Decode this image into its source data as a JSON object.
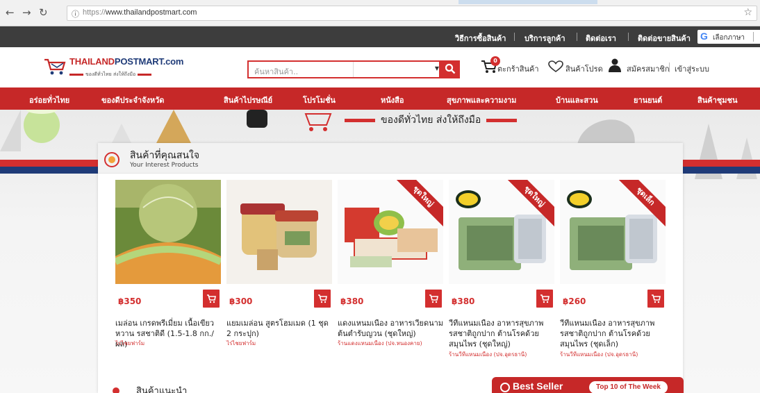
{
  "browser": {
    "url_scheme": "https://",
    "url_host": "www.thailandpostmart.com",
    "icons": [
      "back-icon",
      "forward-icon",
      "reload-icon",
      "info-icon",
      "bookmark-star-icon"
    ]
  },
  "topbar": {
    "links": [
      "วิธีการซื้อสินค้า",
      "บริการลูกค้า",
      "ติดต่อเรา",
      "ติดต่อขายสินค้า"
    ],
    "language_label": "เลือกภาษา"
  },
  "header": {
    "logo_brand_red": "THAILAND",
    "logo_brand_blue": "POSTMART.com",
    "logo_tagline": "ของดีทั่วไทย ส่งให้ถึงมือ",
    "search_placeholder": "ค้นหาสินค้า..",
    "cart_count": "0",
    "cart_label": "ตะกร้าสินค้า",
    "wishlist_label": "สินค้าโปรด",
    "register_label": "สมัครสมาชิก",
    "login_label": "เข้าสู่ระบบ"
  },
  "categories": [
    "อร่อยทั่วไทย",
    "ของดีประจำจังหวัด",
    "สินค้าไปรษณีย์",
    "โปรโมชั่น",
    "หนังสือ",
    "สุขภาพและความงาม",
    "บ้านและสวน",
    "ยานยนต์",
    "สินค้าชุมชน"
  ],
  "hero": {
    "tagline": "ของดีทั่วไทย ส่งให้ถึงมือ"
  },
  "interest": {
    "title": "สินค้าที่คุณสนใจ",
    "subtitle": "Your Interest Products",
    "products": [
      {
        "price": "฿350",
        "name": "เมล่อน เกรดพรีเมี่ยม เนื้อเขียว หวาน รสชาติดี (1.5-1.8 กก./ผล)",
        "shop": "ไร่ไชยฟาร์ม",
        "ribbon": ""
      },
      {
        "price": "฿300",
        "name": "แยมเมล่อน สูตรโฮมเมด (1 ชุด 2 กระปุก)",
        "shop": "ไร่ไชยฟาร์ม",
        "ribbon": ""
      },
      {
        "price": "฿380",
        "name": "แดงแหนมเนือง อาหารเวียดนาม ต้นตำรับญวน (ชุดใหญ่)",
        "shop": "ร้านแดงแหนมเนือง (ปจ.หนองคาย)",
        "ribbon": "ชุดใหญ่"
      },
      {
        "price": "฿380",
        "name": "วีทีแหนมเนือง อาหารสุขภาพ รสชาติถูกปาก ต้านโรคด้วย สมุนไพร (ชุดใหญ่)",
        "shop": "ร้านวีทีแหนมเนือง (ปจ.อุดรธานี)",
        "ribbon": "ชุดใหญ่"
      },
      {
        "price": "฿260",
        "name": "วีทีแหนมเนือง อาหารสุขภาพ รสชาติถูกปาก ต้านโรคด้วย สมุนไพร (ชุดเล็ก)",
        "shop": "ร้านวีทีแหนมเนือง (ปจ.อุดรธานี)",
        "ribbon": "ชุดเล็ก"
      }
    ]
  },
  "recommended_title": "สินค้าแนะนำ",
  "bestseller": {
    "label": "Best Seller",
    "tag": "Top 10 of The Week"
  },
  "colors": {
    "brand_red": "#c62828",
    "brand_blue": "#1f3b78",
    "topbar": "#3d3d3d"
  }
}
